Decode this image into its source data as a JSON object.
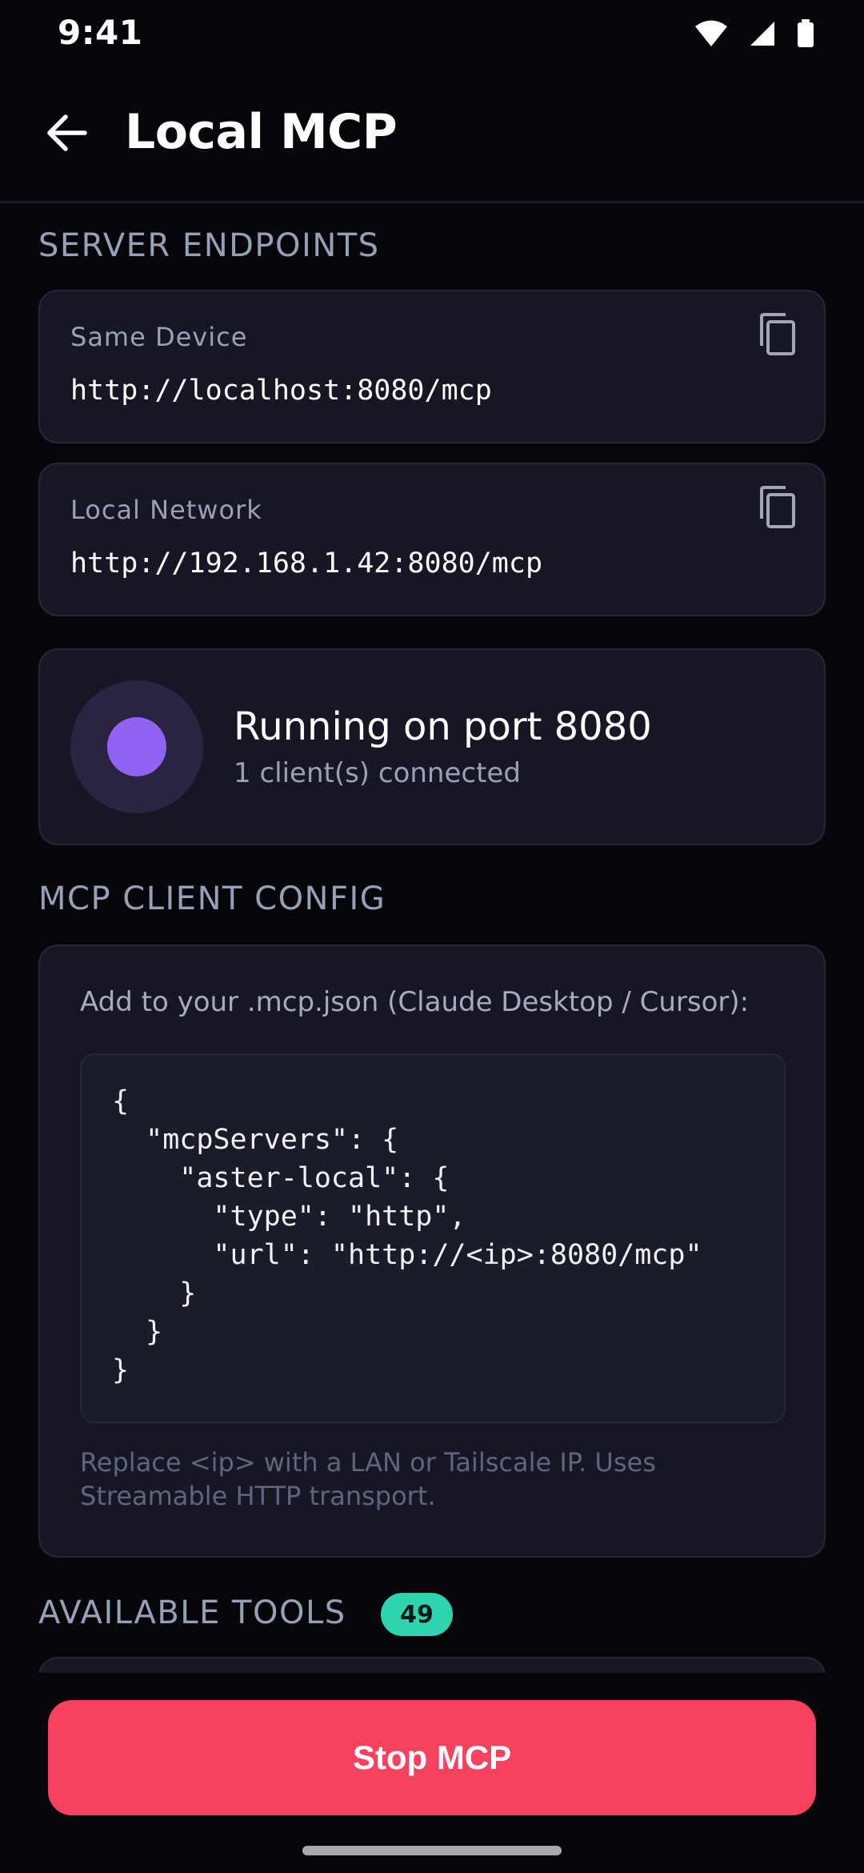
{
  "status_bar": {
    "time": "9:41",
    "icons": [
      "wifi-icon",
      "cellular-signal-icon",
      "battery-icon"
    ]
  },
  "app_bar": {
    "back_icon": "arrow-left-icon",
    "title": "Local MCP"
  },
  "server_endpoints": {
    "section_title": "SERVER ENDPOINTS",
    "items": [
      {
        "label": "Same Device",
        "url": "http://localhost:8080/mcp",
        "action_icon": "copy-icon"
      },
      {
        "label": "Local Network",
        "url": "http://192.168.1.42:8080/mcp",
        "action_icon": "copy-icon"
      }
    ]
  },
  "server_status": {
    "title": "Running on port 8080",
    "subtitle": "1 client(s) connected",
    "indicator_color": "#9063f5"
  },
  "client_config": {
    "section_title": "MCP CLIENT CONFIG",
    "intro": "Add to your .mcp.json (Claude Desktop / Cursor):",
    "code": "{\n  \"mcpServers\": {\n    \"aster-local\": {\n      \"type\": \"http\",\n      \"url\": \"http://<ip>:8080/mcp\"\n    }\n  }\n}",
    "note": "Replace <ip> with a LAN or Tailscale IP. Uses Streamable HTTP transport."
  },
  "available_tools": {
    "section_title": "AVAILABLE TOOLS",
    "count": "49",
    "badge_color": "#2ed3b0"
  },
  "actions": {
    "stop_label": "Stop MCP",
    "stop_color": "#f6425f"
  }
}
